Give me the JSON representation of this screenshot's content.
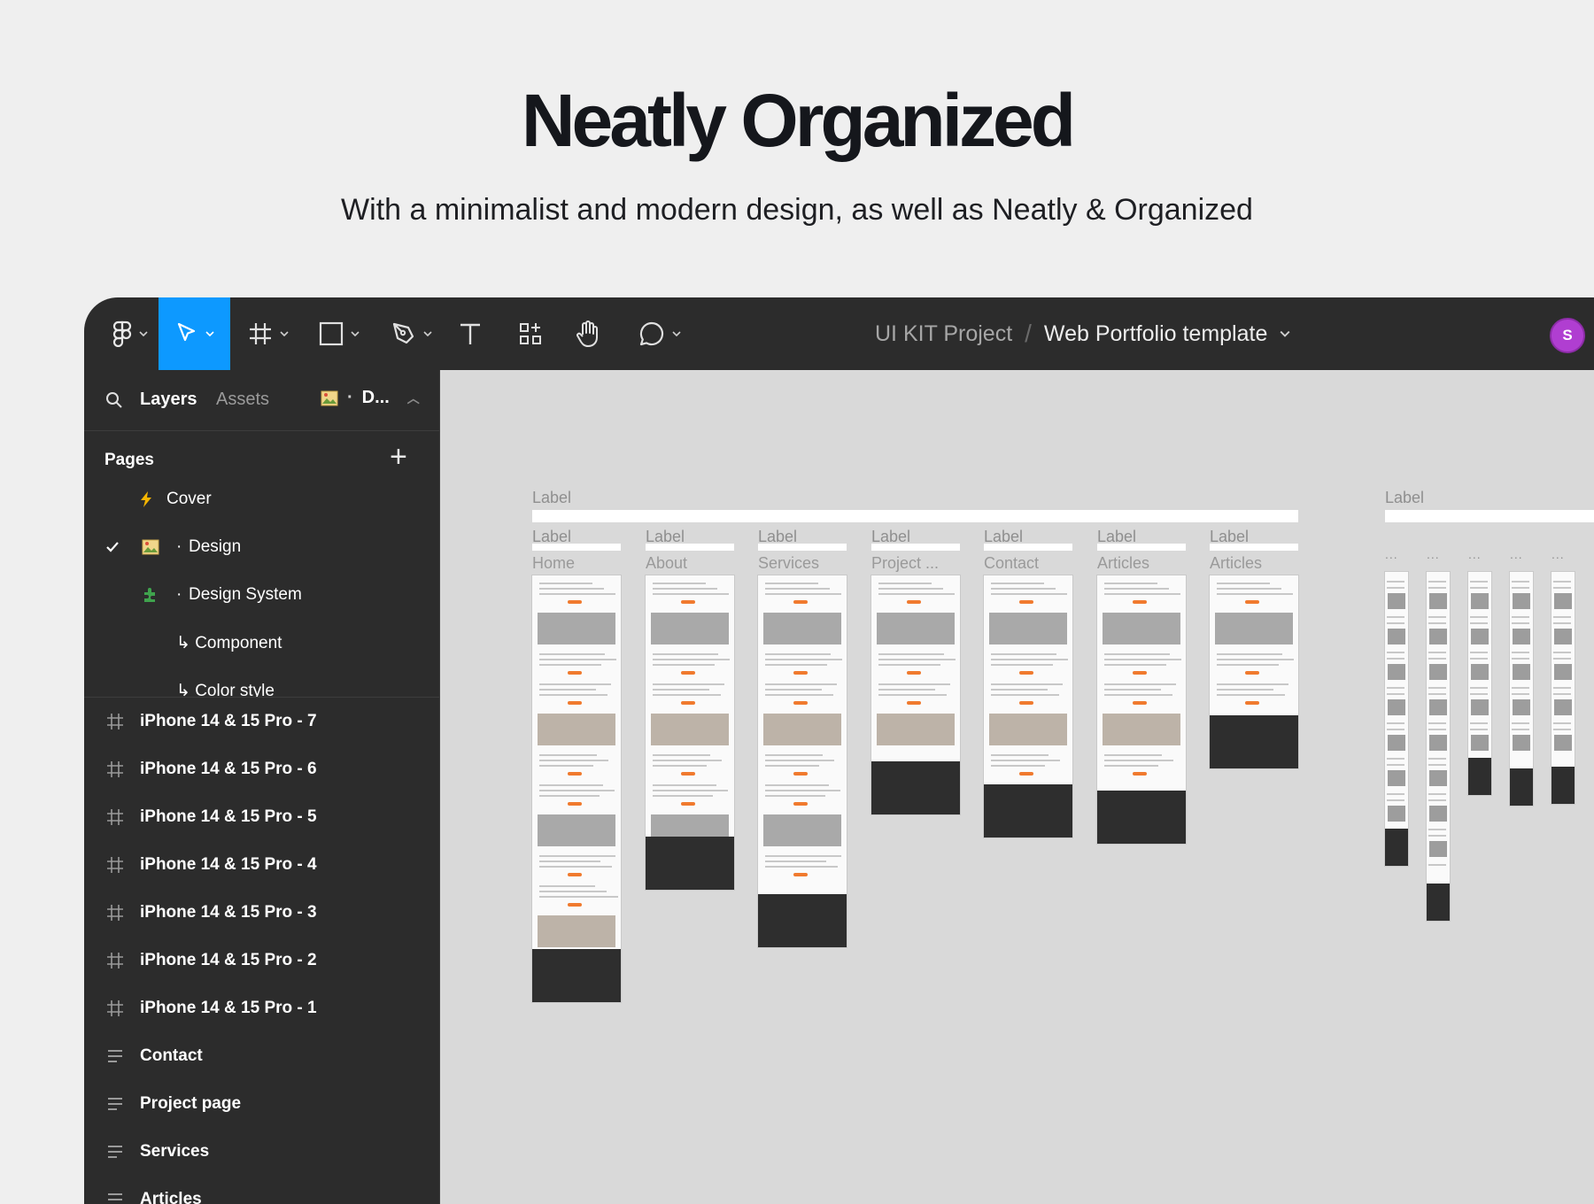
{
  "hero": {
    "title": "Neatly Organized",
    "subtitle": "With a minimalist and modern design, as well as Neatly & Organized"
  },
  "toolbar": {
    "tools": [
      "figma-menu",
      "move",
      "frame",
      "shape",
      "pen",
      "text",
      "resources",
      "hand",
      "comment"
    ],
    "active_tool": "move",
    "accent_color": "#0d99ff"
  },
  "breadcrumb": {
    "project": "UI KIT Project",
    "separator": "/",
    "file": "Web Portfolio template"
  },
  "user": {
    "initial": "S",
    "color": "#b03ed1"
  },
  "sidebar": {
    "tab_layers": "Layers",
    "tab_assets": "Assets",
    "current_page": "D...",
    "pages_heading": "Pages",
    "pages": [
      {
        "label": "Cover",
        "icon": "lightning-icon"
      },
      {
        "label": "Design",
        "icon": "image-icon",
        "selected": true
      },
      {
        "label": "Design System",
        "icon": "puzzle-icon"
      },
      {
        "label": "↳ Component",
        "icon": ""
      },
      {
        "label": "↳ Color style",
        "icon": ""
      }
    ],
    "layers": [
      {
        "label": "iPhone 14 & 15 Pro - 7",
        "icon": "frame-icon"
      },
      {
        "label": "iPhone 14 & 15 Pro - 6",
        "icon": "frame-icon"
      },
      {
        "label": "iPhone 14 & 15 Pro - 5",
        "icon": "frame-icon"
      },
      {
        "label": "iPhone 14 & 15 Pro - 4",
        "icon": "frame-icon"
      },
      {
        "label": "iPhone 14 & 15 Pro - 3",
        "icon": "frame-icon"
      },
      {
        "label": "iPhone 14 & 15 Pro - 2",
        "icon": "frame-icon"
      },
      {
        "label": "iPhone 14 & 15 Pro - 1",
        "icon": "frame-icon"
      },
      {
        "label": "Contact",
        "icon": "section-icon"
      },
      {
        "label": "Project page",
        "icon": "section-icon"
      },
      {
        "label": "Services",
        "icon": "section-icon"
      },
      {
        "label": "Articles",
        "icon": "section-icon"
      }
    ]
  },
  "canvas": {
    "section_label": "Label",
    "frame_label": "Label",
    "frames": [
      "Home",
      "About",
      "Services",
      "Project ...",
      "Contact",
      "Articles",
      "Articles"
    ],
    "mobile_frame_label": "..."
  }
}
